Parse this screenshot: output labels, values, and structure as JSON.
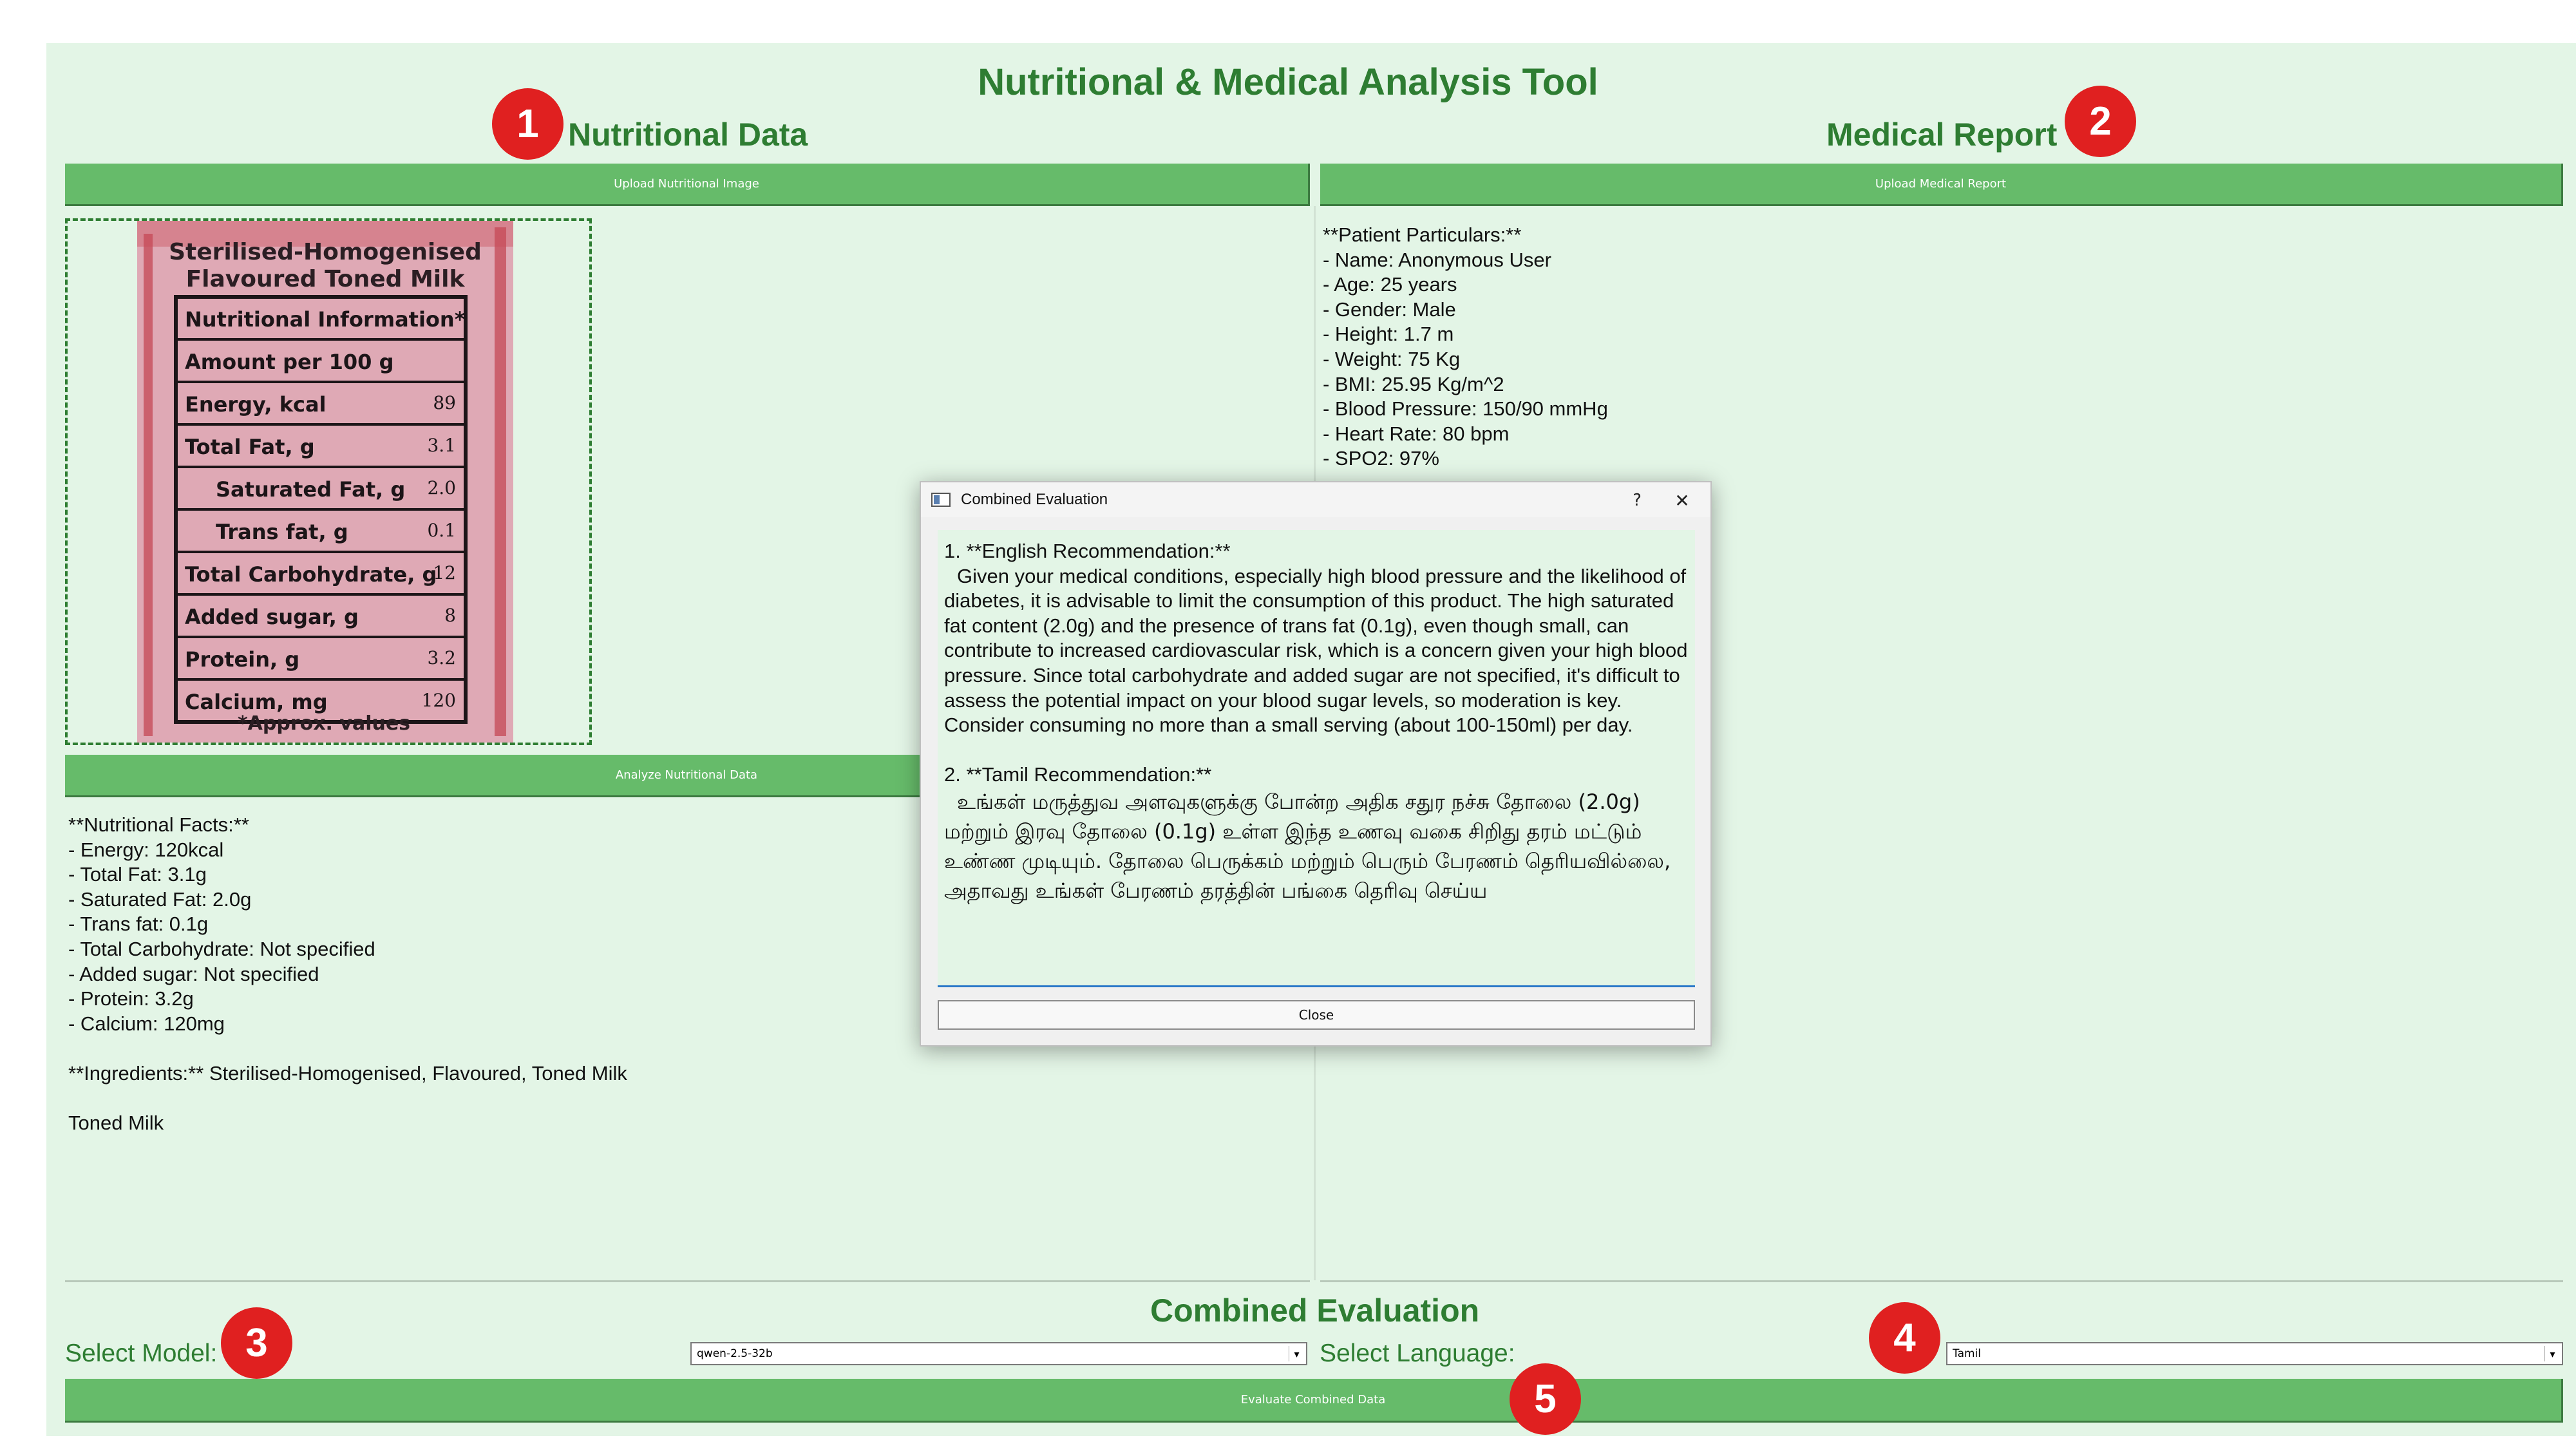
{
  "app": {
    "title": "Nutritional & Medical Analysis Tool"
  },
  "nutrition": {
    "heading": "Nutritional Data",
    "upload_label": "Upload Nutritional Image",
    "analyze_label": "Analyze Nutritional Data",
    "label_image": {
      "product_line1": "Sterilised-Homogenised",
      "product_line2": "Flavoured Toned Milk",
      "rows": [
        {
          "name": "Nutritional Information*",
          "value": ""
        },
        {
          "name": "Amount per 100 g",
          "value": ""
        },
        {
          "name": "Energy, kcal",
          "value": "89"
        },
        {
          "name": "Total Fat, g",
          "value": "3.1"
        },
        {
          "name": "Saturated Fat, g",
          "value": "2.0"
        },
        {
          "name": "Trans fat, g",
          "value": "0.1"
        },
        {
          "name": "Total Carbohydrate, g",
          "value": "12"
        },
        {
          "name": "Added sugar, g",
          "value": "8"
        },
        {
          "name": "Protein, g",
          "value": "3.2"
        },
        {
          "name": "Calcium, mg",
          "value": "120"
        }
      ],
      "footnote": "*Approx. values"
    },
    "output_text": "**Nutritional Facts:**\n- Energy: 120kcal\n- Total Fat: 3.1g\n- Saturated Fat: 2.0g\n- Trans fat: 0.1g\n- Total Carbohydrate: Not specified\n- Added sugar: Not specified\n- Protein: 3.2g\n- Calcium: 120mg\n\n**Ingredients:** Sterilised-Homogenised, Flavoured, Toned Milk\n\nToned Milk"
  },
  "medical": {
    "heading": "Medical Report",
    "upload_label": "Upload Medical Report",
    "output_text": "**Patient Particulars:**\n- Name: Anonymous User\n- Age: 25 years\n- Gender: Male\n- Height: 1.7 m\n- Weight: 75 Kg\n- BMI: 25.95 Kg/m^2\n- Blood Pressure: 150/90 mmHg\n- Heart Rate: 80 bpm\n- SPO2: 97%"
  },
  "combined": {
    "heading": "Combined Evaluation",
    "model_label": "Select Model:",
    "model_value": "qwen-2.5-32b",
    "language_label": "Select Language:",
    "language_value": "Tamil",
    "evaluate_label": "Evaluate Combined Data"
  },
  "dialog": {
    "title": "Combined Evaluation",
    "help_glyph": "?",
    "close_glyph": "✕",
    "english_heading": "1. **English Recommendation:**",
    "english_text": "Given your medical conditions, especially high blood pressure and the likelihood of diabetes, it is advisable to limit the consumption of this product. The high saturated fat content (2.0g) and the presence of trans fat (0.1g), even though small, can contribute to increased cardiovascular risk, which is a concern given your high blood pressure. Since total carbohydrate and added sugar are not specified, it's difficult to assess the potential impact on your blood sugar levels, so moderation is key. Consider consuming no more than a small serving (about 100-150ml) per day.",
    "tamil_heading": "2. **Tamil Recommendation:**",
    "tamil_text": "உங்கள் மருத்துவ அளவுகளுக்கு போன்ற அதிக சதுர நச்சு தோலை (2.0g) மற்றும் இரவு தோலை (0.1g) உள்ள இந்த உணவு வகை சிறிது தரம் மட்டும் உண்ண முடியும். தோலை பெருக்கம் மற்றும் பெரும் பேரணம் தெரியவில்லை, அதாவது உங்கள் பேரணம் தரத்தின் பங்கை தெரிவு செய்ய",
    "close_label": "Close"
  },
  "badges": [
    "1",
    "2",
    "3",
    "4",
    "5"
  ],
  "colors": {
    "background": "#e3f5e6",
    "accent": "#66bb6a",
    "heading": "#2e7d32",
    "badge": "#e02020"
  }
}
